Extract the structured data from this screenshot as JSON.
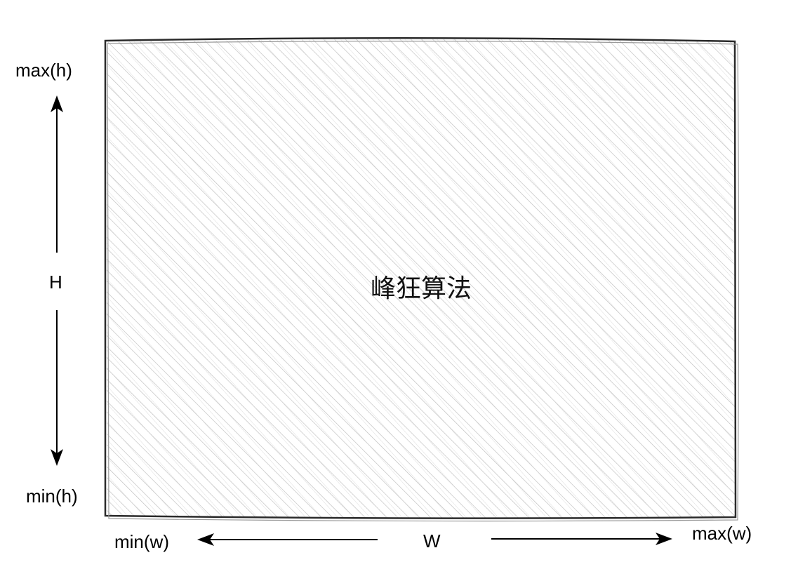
{
  "diagram": {
    "center_label": "峰狂算法",
    "height_axis": {
      "top_label": "max(h)",
      "middle_label": "H",
      "bottom_label": "min(h)"
    },
    "width_axis": {
      "left_label": "min(w)",
      "middle_label": "W",
      "right_label": "max(w)"
    }
  },
  "colors": {
    "stroke": "#222222",
    "hatch": "#b8b8b8",
    "arrow": "#000000",
    "background": "#ffffff"
  }
}
